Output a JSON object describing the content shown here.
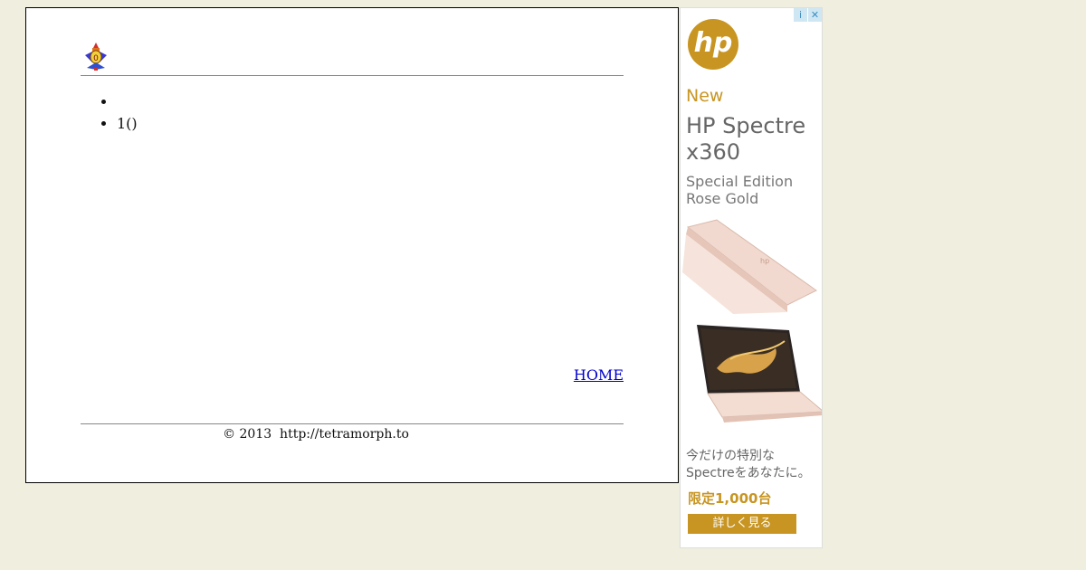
{
  "list": {
    "items": [
      "",
      "1()"
    ]
  },
  "nav": {
    "home_label": "HOME"
  },
  "footer": {
    "text": "© 2013  http://tetramorph.to"
  },
  "ad": {
    "brand": "hp",
    "new_label": "New",
    "title": "HP Spectre x360",
    "subtitle": "Special Edition Rose Gold",
    "jp_text": "今だけの特別な Spectreをあなたに。",
    "limit_text": "限定1,000台",
    "cta_label": "詳しく見る",
    "info_icon": "i",
    "close_icon": "✕",
    "accent_color": "#c89522"
  },
  "colors": {
    "page_bg": "#efeedf",
    "link": "#0000cc"
  }
}
